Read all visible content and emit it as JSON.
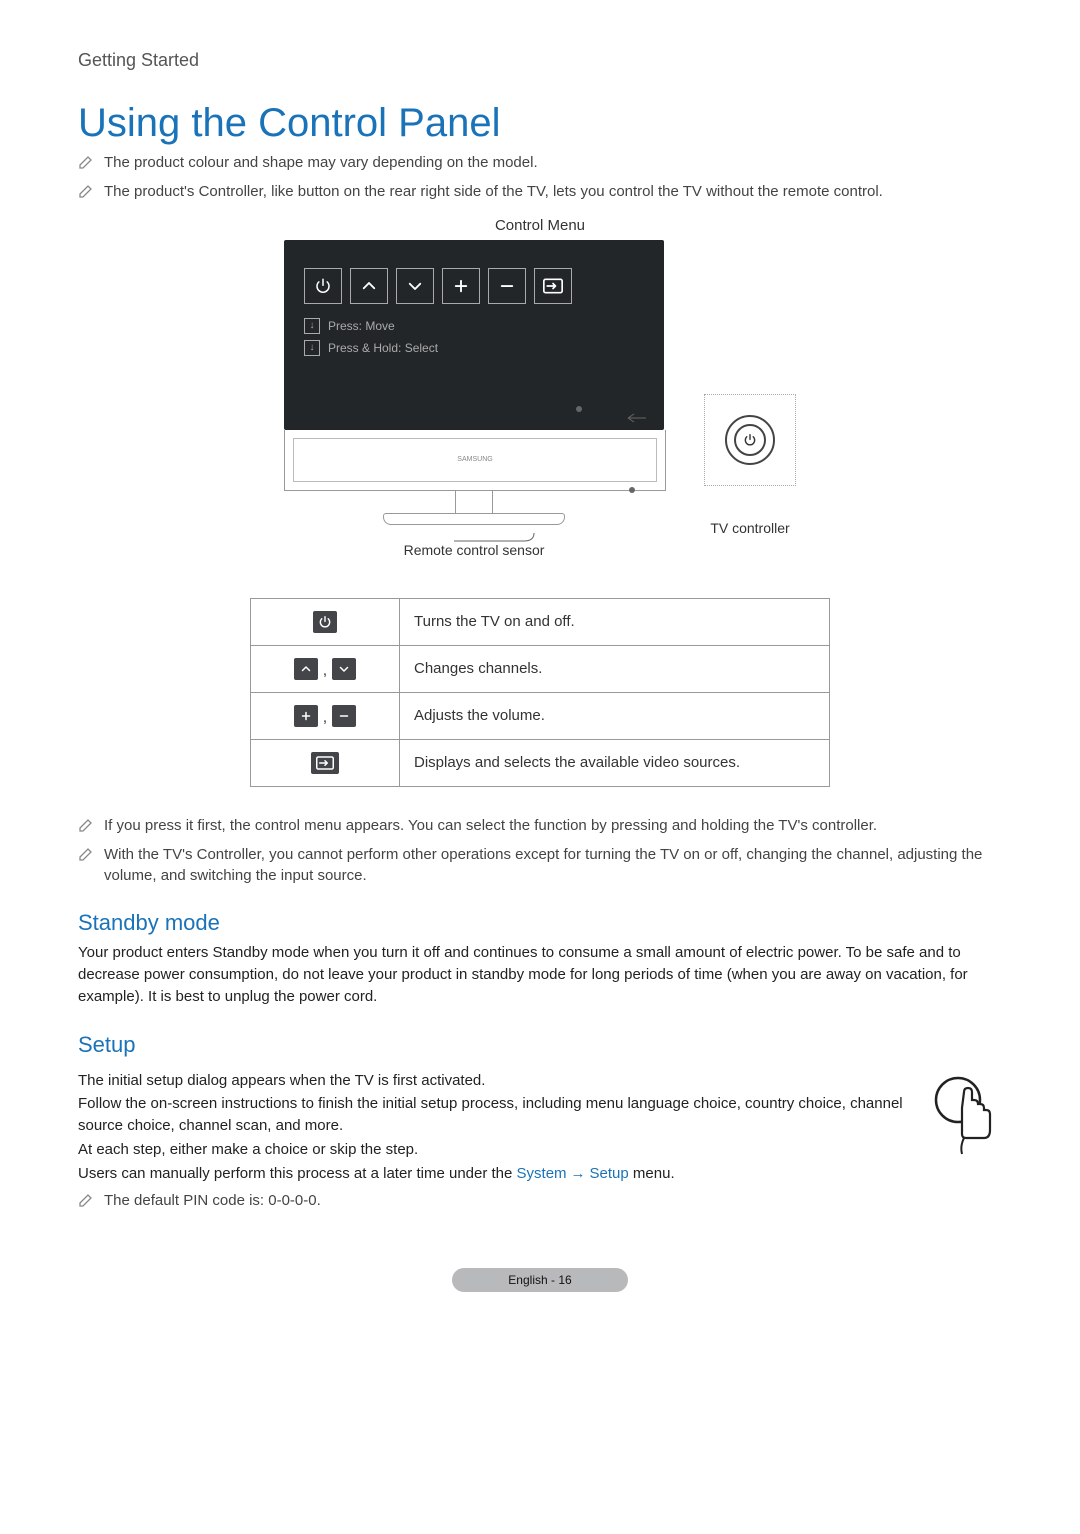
{
  "breadcrumb": "Getting Started",
  "title": "Using the Control Panel",
  "intro_notes": [
    "The product colour and shape may vary depending on the model.",
    "The product's Controller, like button on the rear right side of the TV, lets you control the TV without the remote control."
  ],
  "figure": {
    "control_menu_label": "Control Menu",
    "hint_press": "Press: Move",
    "hint_hold": "Press & Hold: Select",
    "remote_sensor_label": "Remote control sensor",
    "tv_controller_label": "TV controller",
    "brand": "SAMSUNG"
  },
  "table_rows": [
    {
      "icons": [
        "power"
      ],
      "desc": "Turns the TV on and off."
    },
    {
      "icons": [
        "up",
        "down"
      ],
      "sep": " , ",
      "desc": "Changes channels."
    },
    {
      "icons": [
        "plus",
        "minus"
      ],
      "sep": " , ",
      "desc": "Adjusts the volume."
    },
    {
      "icons": [
        "source"
      ],
      "desc": "Displays and selects the available video sources."
    }
  ],
  "post_notes": [
    "If you press it first, the control menu appears. You can select the function by pressing and holding the TV's controller.",
    "With the TV's Controller, you cannot perform other operations except for turning the TV on or off, changing the channel, adjusting the volume, and switching the input source."
  ],
  "standby": {
    "heading": "Standby mode",
    "body": "Your product enters Standby mode when you turn it off and continues to consume a small amount of electric power. To be safe and to decrease power consumption, do not leave your product in standby mode for long periods of time (when you are away on vacation, for example). It is best to unplug the power cord."
  },
  "setup": {
    "heading": "Setup",
    "p1": "The initial setup dialog appears when the TV is first activated.",
    "p2": "Follow the on-screen instructions to finish the initial setup process, including menu language choice, country choice, channel source choice, channel scan, and more.",
    "p3": "At each step, either make a choice or skip the step.",
    "p4_prefix": "Users can manually perform this process at a later time under the ",
    "p4_link1": "System",
    "p4_arrow": "→",
    "p4_link2": "Setup",
    "p4_suffix": " menu.",
    "note": "The default PIN code is: 0-0-0-0."
  },
  "footer": {
    "lang": "English",
    "sep": " - ",
    "page": "16"
  },
  "icon_glyphs": {
    "power": "⏻",
    "up": "︿",
    "down": "﹀",
    "plus": "＋",
    "minus": "－",
    "source": "⥺",
    "arrow_down": "↓"
  }
}
